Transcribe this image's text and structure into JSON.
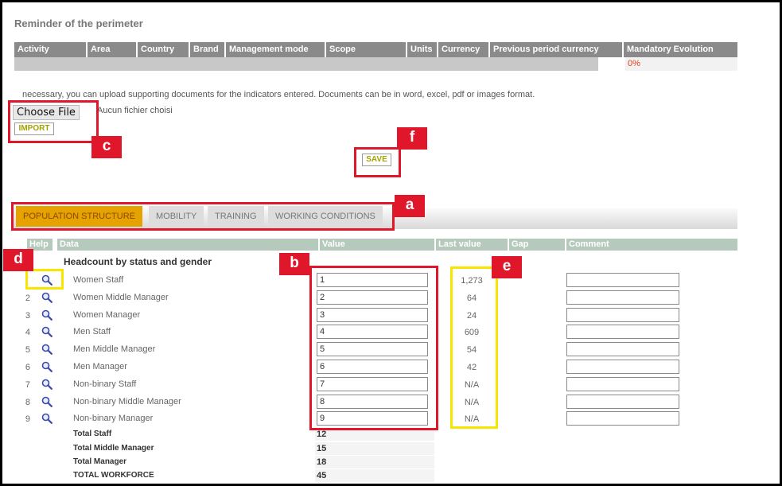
{
  "perimeter": {
    "title": "Reminder of the perimeter",
    "columns": [
      "Activity",
      "Area",
      "Country",
      "Brand",
      "Management mode",
      "Scope",
      "Units",
      "Currency",
      "Previous period currency",
      "Mandatory Evolution"
    ],
    "mandatory_evolution": "0%"
  },
  "upload": {
    "text": "necessary, you can upload supporting documents for the indicators entered. Documents can be in word, excel, pdf or images format.",
    "choose_file_label": "Choose File",
    "no_file_text": "Aucun fichier choisi",
    "import_label": "IMPORT"
  },
  "save_label": "SAVE",
  "tabs": [
    {
      "label": "POPULATION STRUCTURE",
      "active": true
    },
    {
      "label": "MOBILITY",
      "active": false
    },
    {
      "label": "TRAINING",
      "active": false
    },
    {
      "label": "WORKING CONDITIONS",
      "active": false
    }
  ],
  "grid": {
    "headers": {
      "help": "Help",
      "data": "Data",
      "value": "Value",
      "last_value": "Last value",
      "gap": "Gap",
      "comment": "Comment"
    },
    "section_title": "Headcount by status and gender",
    "rows": [
      {
        "num": "",
        "label": "Women Staff",
        "value": "1",
        "last": "1,273"
      },
      {
        "num": "2",
        "label": "Women Middle Manager",
        "value": "2",
        "last": "64"
      },
      {
        "num": "3",
        "label": "Women Manager",
        "value": "3",
        "last": "24"
      },
      {
        "num": "4",
        "label": "Men Staff",
        "value": "4",
        "last": "609"
      },
      {
        "num": "5",
        "label": "Men Middle Manager",
        "value": "5",
        "last": "54"
      },
      {
        "num": "6",
        "label": "Men Manager",
        "value": "6",
        "last": "42"
      },
      {
        "num": "7",
        "label": "Non-binary Staff",
        "value": "7",
        "last": "N/A"
      },
      {
        "num": "8",
        "label": "Non-binary Middle Manager",
        "value": "8",
        "last": "N/A"
      },
      {
        "num": "9",
        "label": "Non-binary Manager",
        "value": "9",
        "last": "N/A"
      }
    ],
    "totals": [
      {
        "label": "Total Staff",
        "value": "12"
      },
      {
        "label": "Total Middle Manager",
        "value": "15"
      },
      {
        "label": "Total Manager",
        "value": "18"
      },
      {
        "label": "TOTAL WORKFORCE",
        "value": "45"
      }
    ]
  },
  "markers": {
    "a": "a",
    "b": "b",
    "c": "c",
    "d": "d",
    "e": "e",
    "f": "f"
  },
  "colors": {
    "active_tab": "#e5a200",
    "header_green": "#b5c9bd",
    "annotation_red": "#e0162b",
    "annotation_yellow": "#f7e600",
    "percent_red": "#e53b1a"
  }
}
